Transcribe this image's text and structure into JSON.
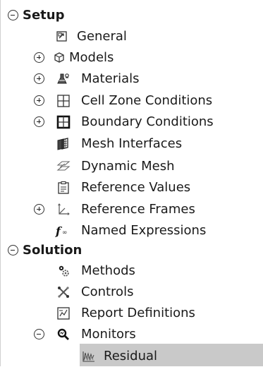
{
  "tree": {
    "setup": {
      "label": "Setup",
      "children": {
        "general": "General",
        "models": "Models",
        "materials": "Materials",
        "cell_zone_conditions": "Cell Zone Conditions",
        "boundary_conditions": "Boundary Conditions",
        "mesh_interfaces": "Mesh Interfaces",
        "dynamic_mesh": "Dynamic Mesh",
        "reference_values": "Reference Values",
        "reference_frames": "Reference Frames",
        "named_expressions": "Named Expressions"
      }
    },
    "solution": {
      "label": "Solution",
      "children": {
        "methods": "Methods",
        "controls": "Controls",
        "report_definitions": "Report Definitions",
        "monitors": "Monitors",
        "residual": "Residual"
      }
    },
    "selected_item": "Residual"
  },
  "icons": {
    "collapse": "minus-circle-icon",
    "expand": "plus-circle-icon",
    "general": "general-settings-icon",
    "models": "models-cube-icon",
    "materials": "materials-flask-icon",
    "cell_zone_conditions": "cell-zone-grid-icon",
    "boundary_conditions": "boundary-grid-icon",
    "mesh_interfaces": "mesh-interfaces-icon",
    "dynamic_mesh": "dynamic-mesh-icon",
    "reference_values": "reference-values-clipboard-icon",
    "reference_frames": "reference-frames-axes-icon",
    "named_expressions": "function-icon",
    "methods": "methods-gears-icon",
    "controls": "controls-icon",
    "report_definitions": "report-definitions-icon",
    "monitors": "monitors-magnifier-icon",
    "residual": "residual-chart-icon"
  },
  "colors": {
    "selection_bg": "#c9c9c9",
    "text": "#1a1a1a"
  }
}
